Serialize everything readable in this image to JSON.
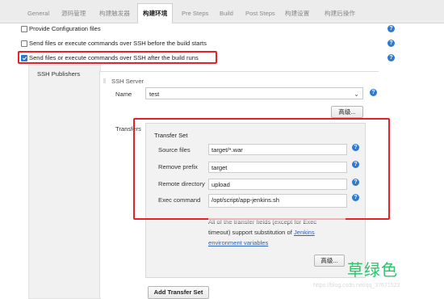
{
  "tabs": [
    {
      "label": "General",
      "active": false
    },
    {
      "label": "源码管理",
      "active": false
    },
    {
      "label": "构建触发器",
      "active": false
    },
    {
      "label": "构建环境",
      "active": true
    },
    {
      "label": "Pre Steps",
      "active": false
    },
    {
      "label": "Build",
      "active": false
    },
    {
      "label": "Post Steps",
      "active": false
    },
    {
      "label": "构建设置",
      "active": false
    },
    {
      "label": "构建后操作",
      "active": false
    }
  ],
  "options": {
    "provide_config": {
      "label": "Provide Configuration files",
      "checked": false
    },
    "ssh_before": {
      "label": "Send files or execute commands over SSH before the build starts",
      "checked": false
    },
    "ssh_after": {
      "label": "Send files or execute commands over SSH after the build runs",
      "checked": true
    }
  },
  "ssh_publishers_label": "SSH Publishers",
  "ssh_server": {
    "title": "SSH Server",
    "name_label": "Name",
    "name_value": "test",
    "advanced_button": "高级..."
  },
  "transfers_label": "Transfers",
  "transfer_set": {
    "title": "Transfer Set",
    "source_files_label": "Source files",
    "source_files_value": "target/*.war",
    "remove_prefix_label": "Remove prefix",
    "remove_prefix_value": "target",
    "remote_directory_label": "Remote directory",
    "remote_directory_value": "upload",
    "exec_command_label": "Exec command",
    "exec_command_value": "/opt/script/app-jenkins.sh",
    "description_line1": "All of the transfer fields (except for Exec",
    "description_line2": "timeout) support substitution of ",
    "description_link": "Jenkins environment variables",
    "advanced_button": "高级..."
  },
  "add_transfer_set_button": "Add Transfer Set",
  "overlay_text": "草绿色",
  "watermark": "https://blog.csdn.net/qq_37671523",
  "colors": {
    "highlight": "#e8202a",
    "help_icon": "#2e7ad1",
    "link": "#2f63b6",
    "overlay": "#2cc36b"
  }
}
